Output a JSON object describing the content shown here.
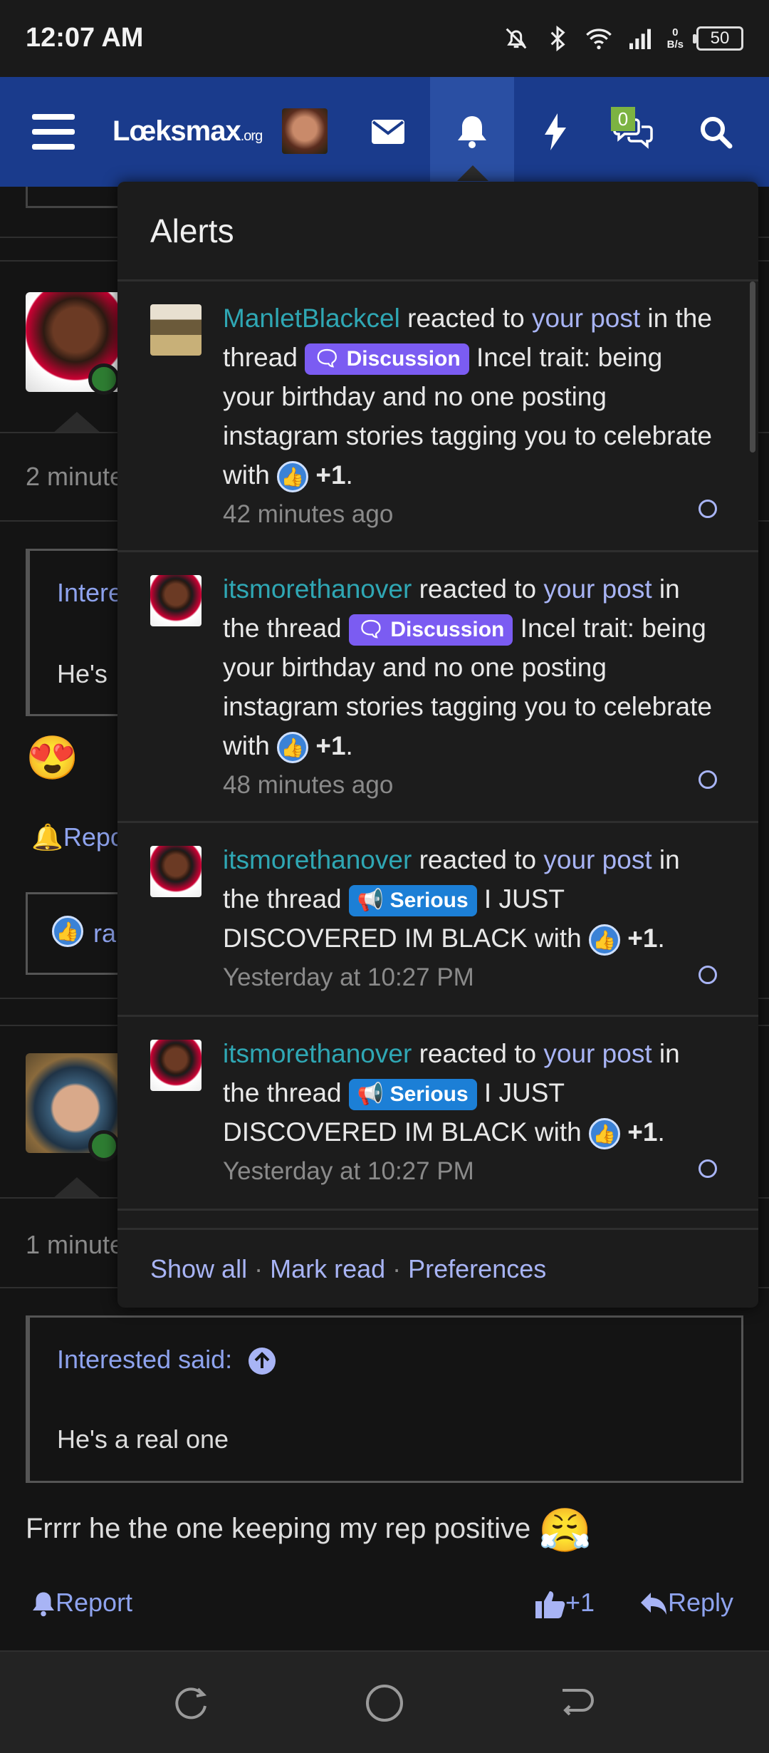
{
  "status_bar": {
    "time": "12:07 AM",
    "net_speed_top": "0",
    "net_speed_bottom": "B/s",
    "battery": "50"
  },
  "header": {
    "logo_main": "Lœksmax",
    "logo_suffix": ".org",
    "conversations_badge": "0"
  },
  "alerts": {
    "title": "Alerts",
    "items": [
      {
        "user": "ManletBlackcel",
        "action": " reacted to ",
        "post_link": "your post",
        "in_thread": " in the thread ",
        "label": "Discussion",
        "thread_title": " Incel trait: being your birthday and no one posting instagram stories tagging you to celebrate with ",
        "reaction": "+1",
        "time": "42 minutes ago"
      },
      {
        "user": "itsmorethanover",
        "action": " reacted to ",
        "post_link": "your post",
        "in_thread": " in the thread ",
        "label": "Discussion",
        "thread_title": " Incel trait: being your birthday and no one posting instagram stories tagging you to celebrate with ",
        "reaction": "+1",
        "time": "48 minutes ago"
      },
      {
        "user": "itsmorethanover",
        "action": " reacted to ",
        "post_link": "your post",
        "in_thread": " in the thread ",
        "label": "Serious",
        "thread_title": " I JUST DISCOVERED IM BLACK with ",
        "reaction": "+1",
        "time": "Yesterday at 10:27 PM"
      },
      {
        "user": "itsmorethanover",
        "action": " reacted to ",
        "post_link": "your post",
        "in_thread": " in the thread ",
        "label": "Serious",
        "thread_title": " I JUST DISCOVERED IM BLACK with ",
        "reaction": "+1",
        "time": "Yesterday at 10:27 PM"
      }
    ],
    "footer": {
      "show_all": "Show all",
      "sep1": " · ",
      "mark_read": "Mark read",
      "sep2": " · ",
      "preferences": "Preferences"
    }
  },
  "background": {
    "post1_time": "2 minute",
    "post1_quote_author": "Intere",
    "post1_quote_text": "He's",
    "post1_report": "Repo",
    "post1_reactor": "rar",
    "post2_time": "1 minute",
    "post2_quote_author": "Interested said:",
    "post2_quote_text": "He's a real one",
    "post2_body": "Frrrr he the one keeping my rep positive",
    "report": "Report",
    "like_count": "+1",
    "reply": "Reply"
  }
}
